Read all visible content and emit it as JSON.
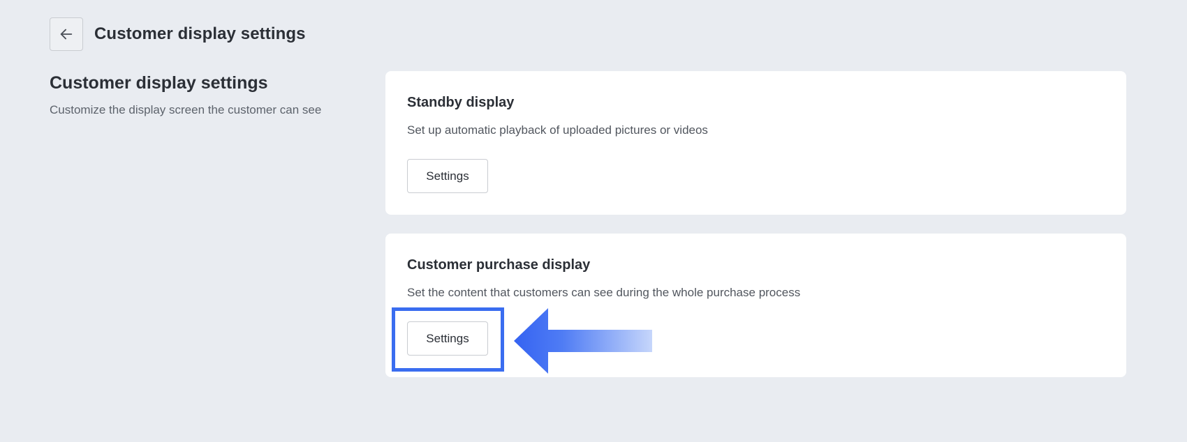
{
  "header": {
    "back_icon": "arrow-left-icon",
    "title": "Customer display settings"
  },
  "section": {
    "title": "Customer display settings",
    "description": "Customize the display screen the customer can see"
  },
  "cards": [
    {
      "title": "Standby display",
      "description": "Set up automatic playback of uploaded pictures or videos",
      "button_label": "Settings"
    },
    {
      "title": "Customer purchase display",
      "description": "Set the content that customers can see during the whole purchase process",
      "button_label": "Settings"
    }
  ],
  "annotation": {
    "highlight_color": "#3a6df0",
    "arrow_icon": "arrow-left-pointer-icon"
  }
}
